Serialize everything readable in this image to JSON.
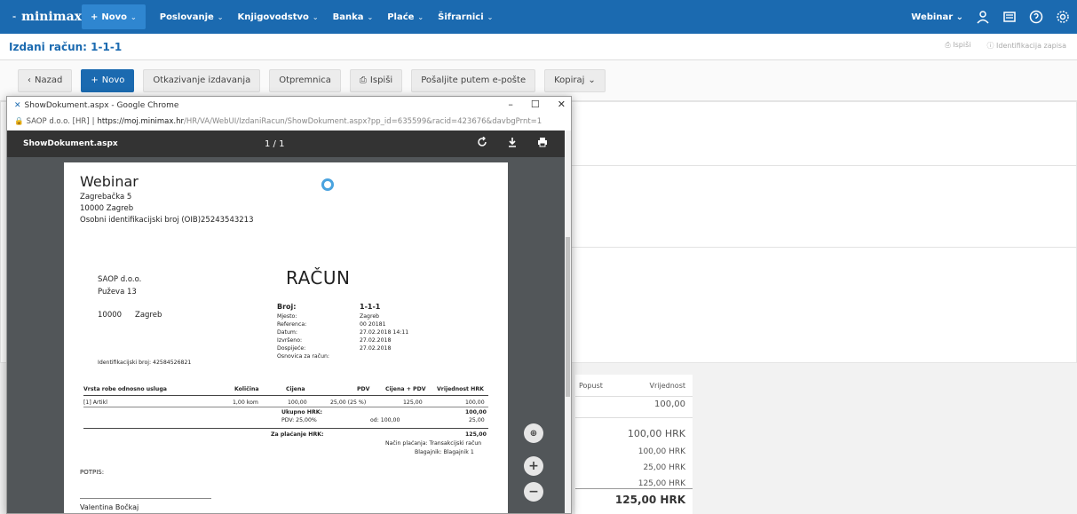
{
  "app": {
    "brand": "minimax"
  },
  "nav": {
    "new_label": "Novo",
    "items": [
      "Poslovanje",
      "Knjigovodstvo",
      "Banka",
      "Plaće",
      "Šifrarnici"
    ],
    "user": "Webinar"
  },
  "page": {
    "title": "Izdani račun: 1-1-1",
    "print_link": "Ispiši",
    "ident_link": "Identifikacija zapisa"
  },
  "toolbar": {
    "back": "Nazad",
    "new": "Novo",
    "cancel_issue": "Otkazivanje izdavanja",
    "delivery_note": "Otpremnica",
    "print": "Ispiši",
    "email": "Pošaljite putem e-pošte",
    "copy": "Kopiraj"
  },
  "summary": {
    "discount_header": "Popust",
    "value_header": "Vrijednost",
    "value": "100,00",
    "total1": "100,00 HRK",
    "r1": "100,00 HRK",
    "r2": "25,00 HRK",
    "r3": "125,00 HRK",
    "grand": "125,00 HRK"
  },
  "chrome": {
    "title": "ShowDokument.aspx - Google Chrome",
    "site": "SAOP d.o.o. [HR]",
    "url_host": "https://moj.minimax.hr",
    "url_path": "/HR/VA/WebUI/IzdaniRacun/ShowDokument.aspx?pp_id=635599&racid=423676&davbgPrnt=1"
  },
  "pdf": {
    "filename": "ShowDokument.aspx",
    "pages": "1 / 1"
  },
  "doc": {
    "company": "Webinar",
    "street": "Zagrebačka 5",
    "city": "10000 Zagreb",
    "oib": "Osobni identifikacijski broj (OIB)25243543213",
    "buyer_name": "SAOP d.o.o.",
    "buyer_street": "Puževa 13",
    "buyer_zip": "10000",
    "buyer_city": "Zagreb",
    "buyer_id": "Identifikacijski broj: 42584526821",
    "heading": "RAČUN",
    "labels": {
      "broj": "Broj:",
      "mjesto": "Mjesto:",
      "referenca": "Referenca:",
      "datum": "Datum:",
      "izvrseno": "Izvršeno:",
      "dospijece": "Dospijeće:",
      "osnovica": "Osnovica za račun:"
    },
    "values": {
      "broj": "1-1-1",
      "mjesto": "Zagreb",
      "referenca": "00 20181",
      "datum": "27.02.2018 14:11",
      "izvrseno": "27.02.2018",
      "dospijece": "27.02.2018"
    },
    "table_headers": [
      "Vrsta robe odnosno usluga",
      "Količina",
      "Cijena",
      "PDV",
      "Cijena + PDV",
      "Vrijednost HRK"
    ],
    "row": {
      "item": "[1] Artikl",
      "qty": "1,00 kom",
      "price": "100,00",
      "vat": "25,00 (25 %)",
      "price_vat": "125,00",
      "value": "100,00"
    },
    "ukupno_label": "Ukupno HRK:",
    "ukupno_value": "100,00",
    "pdv_label": "PDV: 25,00%",
    "pdv_base": "od: 100,00",
    "pdv_value": "25,00",
    "za_placanje_label": "Za plaćanje HRK:",
    "za_placanje_value": "125,00",
    "payment_method": "Način plaćanja: Transakcijski račun",
    "cashier": "Blagajnik: Blagajnik 1",
    "signature_label": "POTPIS:",
    "signer": "Valentina Bočkaj"
  }
}
